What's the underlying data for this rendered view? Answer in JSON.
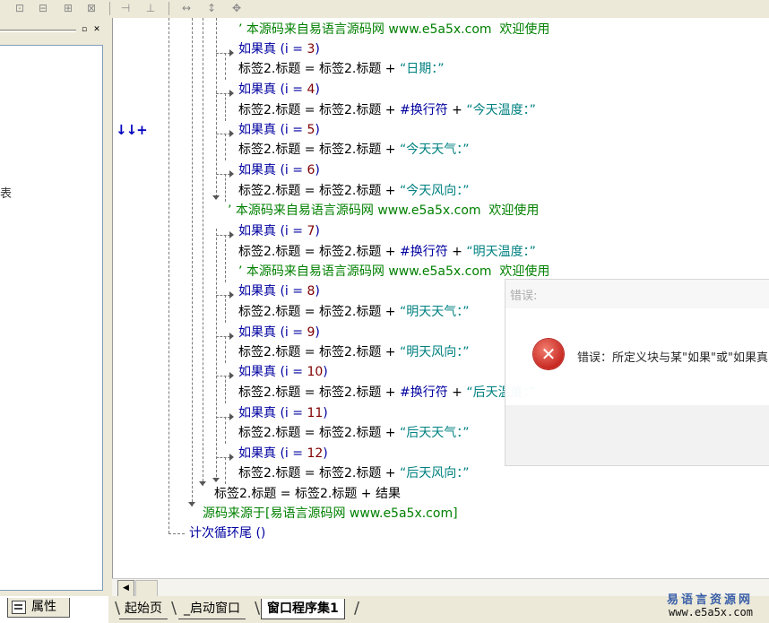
{
  "toolbar": {
    "icons": [
      "align-left-icon",
      "align-center-icon",
      "align-right-icon",
      "align-top-icon",
      "align-hcenter-icon",
      "align-bottom-icon",
      "same-width-icon",
      "same-height-icon",
      "same-size-icon"
    ]
  },
  "left_panel": {
    "truncated_text": "表",
    "property_tab": "属性"
  },
  "code": {
    "loop_marker": "↓↓+",
    "lines": [
      {
        "seg": [
          {
            "t": "’ 本源码来自易语言源码网 ",
            "c": "cmt"
          },
          {
            "t": "www.e5a5x.com",
            "c": "cmt"
          },
          {
            "t": "  欢迎使用",
            "c": "cmt"
          }
        ]
      },
      {
        "seg": [
          {
            "t": "如果真 ",
            "c": "kw"
          },
          {
            "t": "(i = ",
            "c": "kw"
          },
          {
            "t": "3",
            "c": "num"
          },
          {
            "t": ")",
            "c": "kw"
          }
        ]
      },
      {
        "seg": [
          {
            "t": "标签2.标题 = 标签2.标题 + ",
            "c": "txt"
          },
          {
            "t": "“日期：”",
            "c": "str"
          }
        ]
      },
      {
        "seg": [
          {
            "t": "如果真 ",
            "c": "kw"
          },
          {
            "t": "(i = ",
            "c": "kw"
          },
          {
            "t": "4",
            "c": "num"
          },
          {
            "t": ")",
            "c": "kw"
          }
        ]
      },
      {
        "seg": [
          {
            "t": "标签2.标题 = 标签2.标题 + ",
            "c": "txt"
          },
          {
            "t": "#换行符",
            "c": "kw"
          },
          {
            "t": " + ",
            "c": "txt"
          },
          {
            "t": "“今天温度：”",
            "c": "str"
          }
        ]
      },
      {
        "seg": [
          {
            "t": "如果真 ",
            "c": "kw"
          },
          {
            "t": "(i = ",
            "c": "kw"
          },
          {
            "t": "5",
            "c": "num"
          },
          {
            "t": ")",
            "c": "kw"
          }
        ]
      },
      {
        "seg": [
          {
            "t": "标签2.标题 = 标签2.标题 + ",
            "c": "txt"
          },
          {
            "t": "“今天天气：”",
            "c": "str"
          }
        ]
      },
      {
        "seg": [
          {
            "t": "如果真 ",
            "c": "kw"
          },
          {
            "t": "(i = ",
            "c": "kw"
          },
          {
            "t": "6",
            "c": "num"
          },
          {
            "t": ")",
            "c": "kw"
          }
        ]
      },
      {
        "seg": [
          {
            "t": "标签2.标题 = 标签2.标题 + ",
            "c": "txt"
          },
          {
            "t": "“今天风向：”",
            "c": "str"
          }
        ]
      },
      {
        "seg": [
          {
            "t": "’ 本源码来自易语言源码网 ",
            "c": "cmt"
          },
          {
            "t": "www.e5a5x.com",
            "c": "cmt"
          },
          {
            "t": "  欢迎使用",
            "c": "cmt"
          }
        ]
      },
      {
        "seg": [
          {
            "t": "如果真 ",
            "c": "kw"
          },
          {
            "t": "(i = ",
            "c": "kw"
          },
          {
            "t": "7",
            "c": "num"
          },
          {
            "t": ")",
            "c": "kw"
          }
        ]
      },
      {
        "seg": [
          {
            "t": "标签2.标题 = 标签2.标题 + ",
            "c": "txt"
          },
          {
            "t": "#换行符",
            "c": "kw"
          },
          {
            "t": " + ",
            "c": "txt"
          },
          {
            "t": "“明天温度：”",
            "c": "str"
          }
        ]
      },
      {
        "seg": [
          {
            "t": "’ 本源码来自易语言源码网 ",
            "c": "cmt"
          },
          {
            "t": "www.e5a5x.com",
            "c": "cmt"
          },
          {
            "t": "  欢迎使用",
            "c": "cmt"
          }
        ]
      },
      {
        "seg": [
          {
            "t": "如果真 ",
            "c": "kw"
          },
          {
            "t": "(i = ",
            "c": "kw"
          },
          {
            "t": "8",
            "c": "num"
          },
          {
            "t": ")",
            "c": "kw"
          }
        ]
      },
      {
        "seg": [
          {
            "t": "标签2.标题 = 标签2.标题 + ",
            "c": "txt"
          },
          {
            "t": "“明天天气：”",
            "c": "str"
          }
        ]
      },
      {
        "seg": [
          {
            "t": "如果真 ",
            "c": "kw"
          },
          {
            "t": "(i = ",
            "c": "kw"
          },
          {
            "t": "9",
            "c": "num"
          },
          {
            "t": ")",
            "c": "kw"
          }
        ]
      },
      {
        "seg": [
          {
            "t": "标签2.标题 = 标签2.标题 + ",
            "c": "txt"
          },
          {
            "t": "“明天风向：”",
            "c": "str"
          }
        ]
      },
      {
        "seg": [
          {
            "t": "如果真 ",
            "c": "kw"
          },
          {
            "t": "(i = ",
            "c": "kw"
          },
          {
            "t": "10",
            "c": "num"
          },
          {
            "t": ")",
            "c": "kw"
          }
        ]
      },
      {
        "seg": [
          {
            "t": "标签2.标题 = 标签2.标题 + ",
            "c": "txt"
          },
          {
            "t": "#换行符",
            "c": "kw"
          },
          {
            "t": " + ",
            "c": "txt"
          },
          {
            "t": "“后天温度：”",
            "c": "str"
          }
        ]
      },
      {
        "seg": [
          {
            "t": "如果真 ",
            "c": "kw"
          },
          {
            "t": "(i = ",
            "c": "kw"
          },
          {
            "t": "11",
            "c": "num"
          },
          {
            "t": ")",
            "c": "kw"
          }
        ]
      },
      {
        "seg": [
          {
            "t": "标签2.标题 = 标签2.标题 + ",
            "c": "txt"
          },
          {
            "t": "“后天天气：”",
            "c": "str"
          }
        ]
      },
      {
        "seg": [
          {
            "t": "如果真 ",
            "c": "kw"
          },
          {
            "t": "(i = ",
            "c": "kw"
          },
          {
            "t": "12",
            "c": "num"
          },
          {
            "t": ")",
            "c": "kw"
          }
        ]
      },
      {
        "seg": [
          {
            "t": "标签2.标题 = 标签2.标题 + ",
            "c": "txt"
          },
          {
            "t": "“后天风向：”",
            "c": "str"
          }
        ]
      },
      {
        "seg": [
          {
            "t": "标签2.标题 = 标签2.标题 + 结果",
            "c": "txt"
          }
        ]
      },
      {
        "seg": [
          {
            "t": "源码来源于[易语言源码网 ",
            "c": "cmt"
          },
          {
            "t": "www.e5a5x.com",
            "c": "cmt"
          },
          {
            "t": "]",
            "c": "cmt"
          }
        ]
      },
      {
        "seg": [
          {
            "t": "计次循环尾 ()",
            "c": "kw"
          }
        ]
      }
    ]
  },
  "tabs": [
    "起始页",
    "_启动窗口",
    "窗口程序集1"
  ],
  "selected_tab": "窗口程序集1",
  "watermark": {
    "line1": "易语言资源网",
    "line2": "www.e5a5x.com"
  },
  "error_dialog": {
    "title": "错误:",
    "message": "错误：所定义块与某\"如果\"或\"如果真",
    "icon": "error-x-icon"
  },
  "colors": {
    "keyword": "#0000a0",
    "string": "#008080",
    "comment": "#008000",
    "number": "#800000",
    "accent_watermark": "#3a5fa8"
  }
}
